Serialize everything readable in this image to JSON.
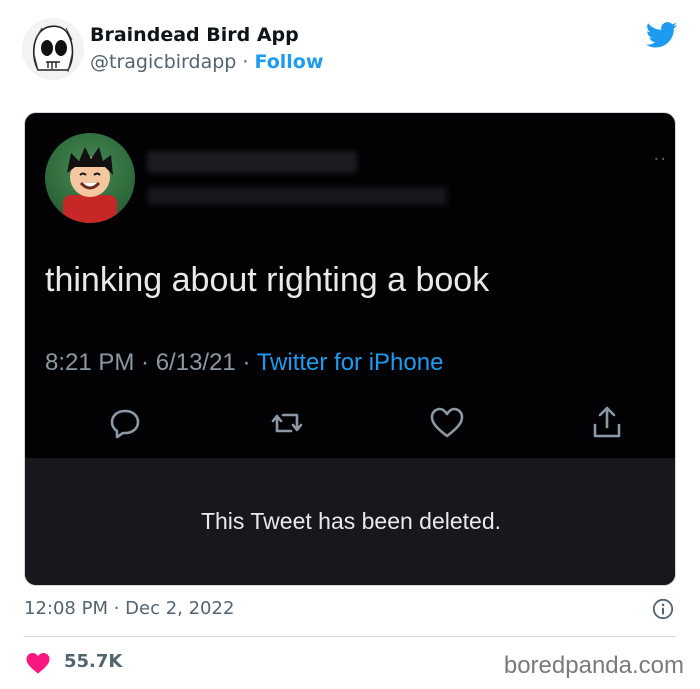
{
  "embed": {
    "display_name": "Braindead Bird App",
    "handle": "@tragicbirdapp",
    "separator": "·",
    "follow_label": "Follow",
    "timestamp": "12:08 PM · Dec 2, 2022",
    "like_count": "55.7K",
    "icons": [
      "twitter-bird-icon",
      "info-icon",
      "heart-icon"
    ],
    "colors": {
      "accent": "#1d9bf0",
      "heart": "#f91880"
    }
  },
  "inner_tweet": {
    "text": "thinking about righting a book",
    "time": "8:21 PM · 6/13/21 · ",
    "source": "Twitter for iPhone",
    "deleted_message": "This Tweet has been deleted.",
    "action_icons": [
      "reply-icon",
      "retweet-icon",
      "like-icon",
      "share-icon"
    ]
  },
  "watermark": "boredpanda.com"
}
